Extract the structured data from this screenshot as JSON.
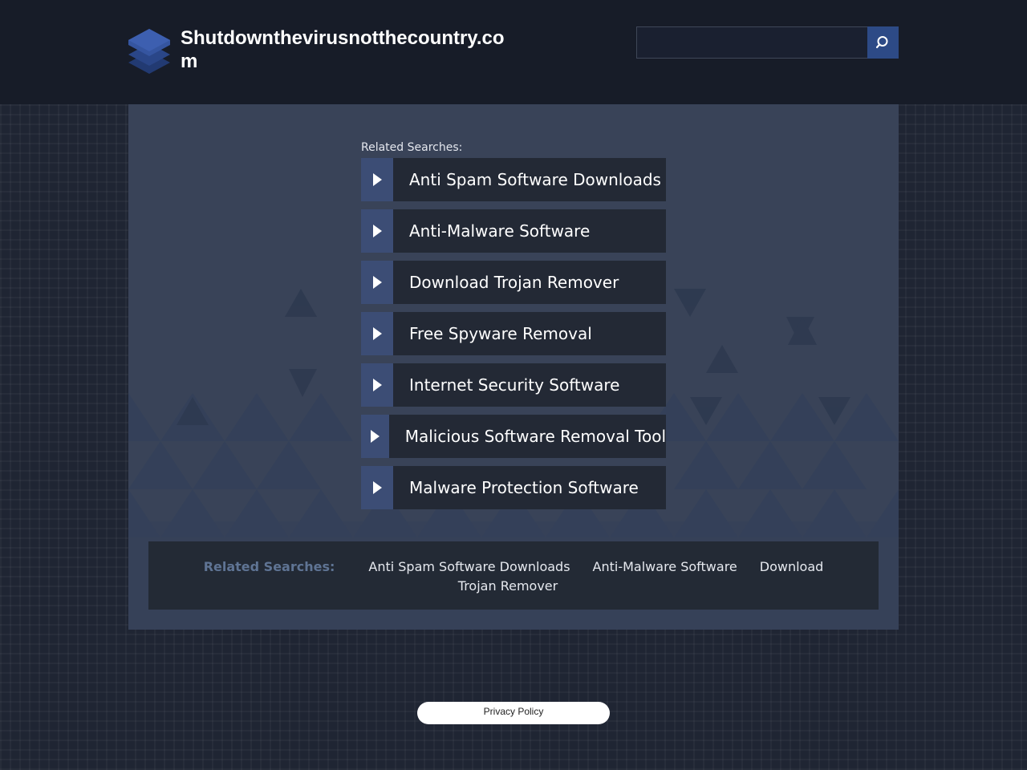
{
  "site": {
    "title": "Shutdownthevirusnotthecountry.com",
    "logo_icon": "stacked-layers-icon"
  },
  "search": {
    "value": "",
    "placeholder": "",
    "button_icon": "search-icon"
  },
  "related": {
    "label": "Related Searches:",
    "items": [
      "Anti Spam Software Downloads",
      "Anti-Malware Software",
      "Download Trojan Remover",
      "Free Spyware Removal",
      "Internet Security Software",
      "Malicious Software Removal Tool",
      "Malware Protection Software"
    ]
  },
  "bottom_bar": {
    "label": "Related Searches:",
    "links": [
      "Anti Spam Software Downloads",
      "Anti-Malware Software",
      "Download Trojan Remover"
    ]
  },
  "footer": {
    "privacy_label": "Privacy Policy"
  },
  "colors": {
    "header_bg": "#171c28",
    "panel_bg": "#394358",
    "accent": "#2d4a86",
    "arrow_cell": "#3c4d75",
    "link_row": "#232935"
  }
}
